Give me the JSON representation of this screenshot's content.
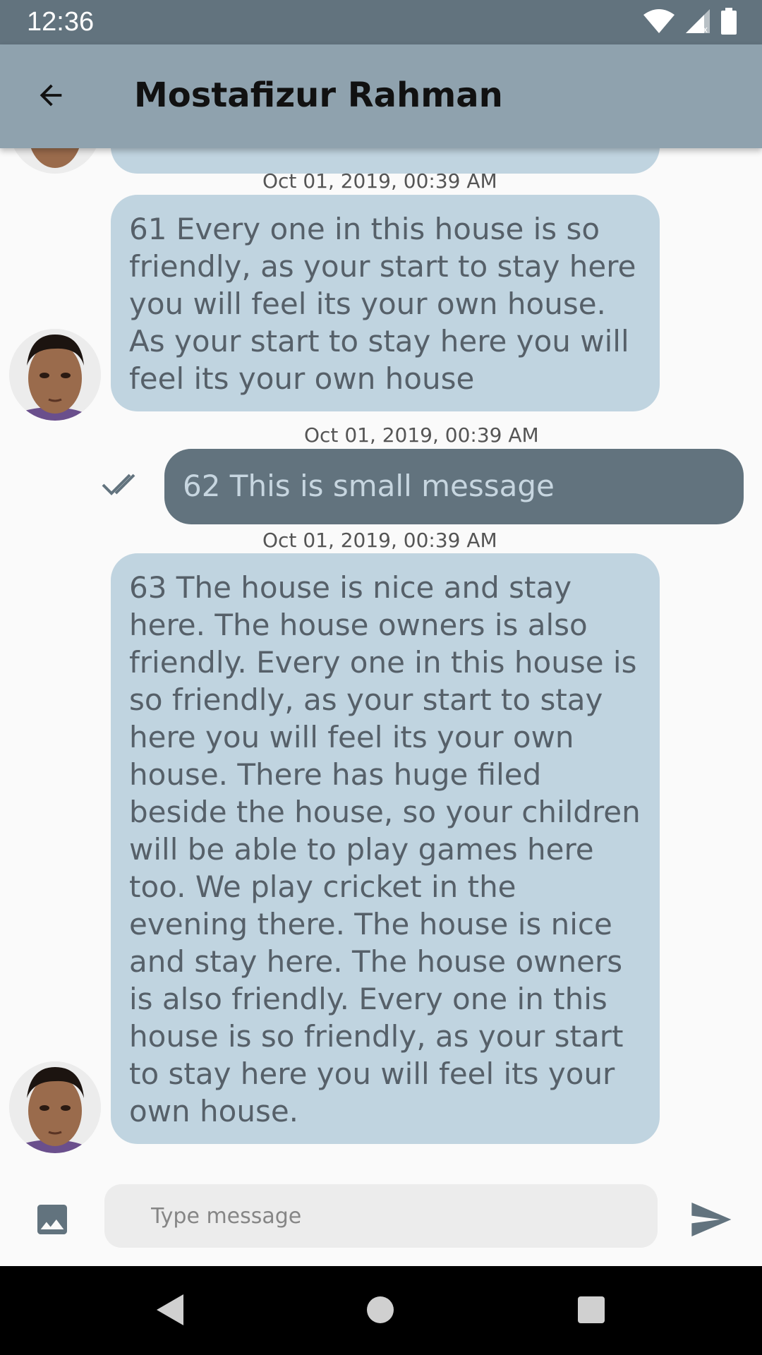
{
  "status_bar": {
    "time": "12:36"
  },
  "app_bar": {
    "title": "Mostafizur Rahman"
  },
  "messages": [
    {
      "direction": "incoming",
      "timestamp": "Oct 01, 2019, 00:39 AM",
      "text": "61 Every one in this house is so friendly, as your start to stay here you will feel its your own house. As your start to stay here you will feel its your own house"
    },
    {
      "direction": "outgoing",
      "timestamp": "Oct 01, 2019, 00:39 AM",
      "text": "62 This is small message",
      "status_icon": "double-check-icon"
    },
    {
      "direction": "incoming",
      "timestamp": "Oct 01, 2019, 00:39 AM",
      "text": "63 The house is nice and stay here. The house owners is also friendly. Every one in this house is so friendly, as your start to stay here you will feel its your own house. There has huge filed beside the house, so your children will be able to play games here too. We play cricket in the evening there. The house is nice and stay here. The house owners is also friendly. Every one in this house is so friendly, as your start to stay here you will feel its your own house."
    }
  ],
  "composer": {
    "placeholder": "Type message",
    "value": ""
  },
  "icons": {
    "back": "arrow-back-icon",
    "image": "image-icon",
    "send": "send-icon",
    "read_receipt": "double-check-icon"
  },
  "colors": {
    "status_bar": "#62737e",
    "app_bar": "#8fa2ae",
    "incoming_bubble": "#c0d4e0",
    "outgoing_bubble": "#62737e",
    "incoming_text": "#566069",
    "outgoing_text": "#c7d6e0"
  }
}
